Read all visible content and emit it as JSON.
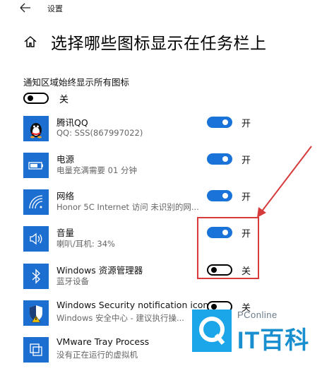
{
  "titlebar": {
    "back_icon": "back-arrow-icon",
    "title": "设置"
  },
  "header": {
    "home_icon": "home-icon",
    "title": "选择哪些图标显示在任务栏上"
  },
  "always_show": {
    "label": "通知区域始终显示所有图标",
    "state": "关",
    "on": false
  },
  "items": [
    {
      "icon": "qq-penguin-icon",
      "name": "腾讯QQ",
      "sub": "QQ: SSS(867997022)",
      "state": "开",
      "on": true
    },
    {
      "icon": "battery-icon",
      "name": "电源",
      "sub": "电量充满需要 01 分钟",
      "state": "开",
      "on": true
    },
    {
      "icon": "wifi-icon",
      "name": "网络",
      "sub": "Honor 5C Internet 访问  未识别的网...",
      "state": "开",
      "on": true
    },
    {
      "icon": "speaker-icon",
      "name": "音量",
      "sub": "喇叭/耳机: 34%",
      "state": "开",
      "on": true
    },
    {
      "icon": "bluetooth-icon",
      "name": "Windows 资源管理器",
      "sub": "蓝牙设备",
      "state": "关",
      "on": false
    },
    {
      "icon": "shield-icon",
      "name": "Windows Security notification icon",
      "sub": "Windows 安全中心 - 建议执行操...",
      "state": "关",
      "on": false
    },
    {
      "icon": "vmware-icon",
      "name": "VMware Tray Process",
      "sub": "没有正在运行的虚拟机",
      "state": "",
      "on": null
    }
  ],
  "watermark": {
    "small": "PConline",
    "big": "IT百科"
  },
  "colors": {
    "accent": "#1a73d9",
    "tile": "#1c6fd1",
    "annotation": "#d63a3a",
    "watermark": "#1a8fd0"
  }
}
